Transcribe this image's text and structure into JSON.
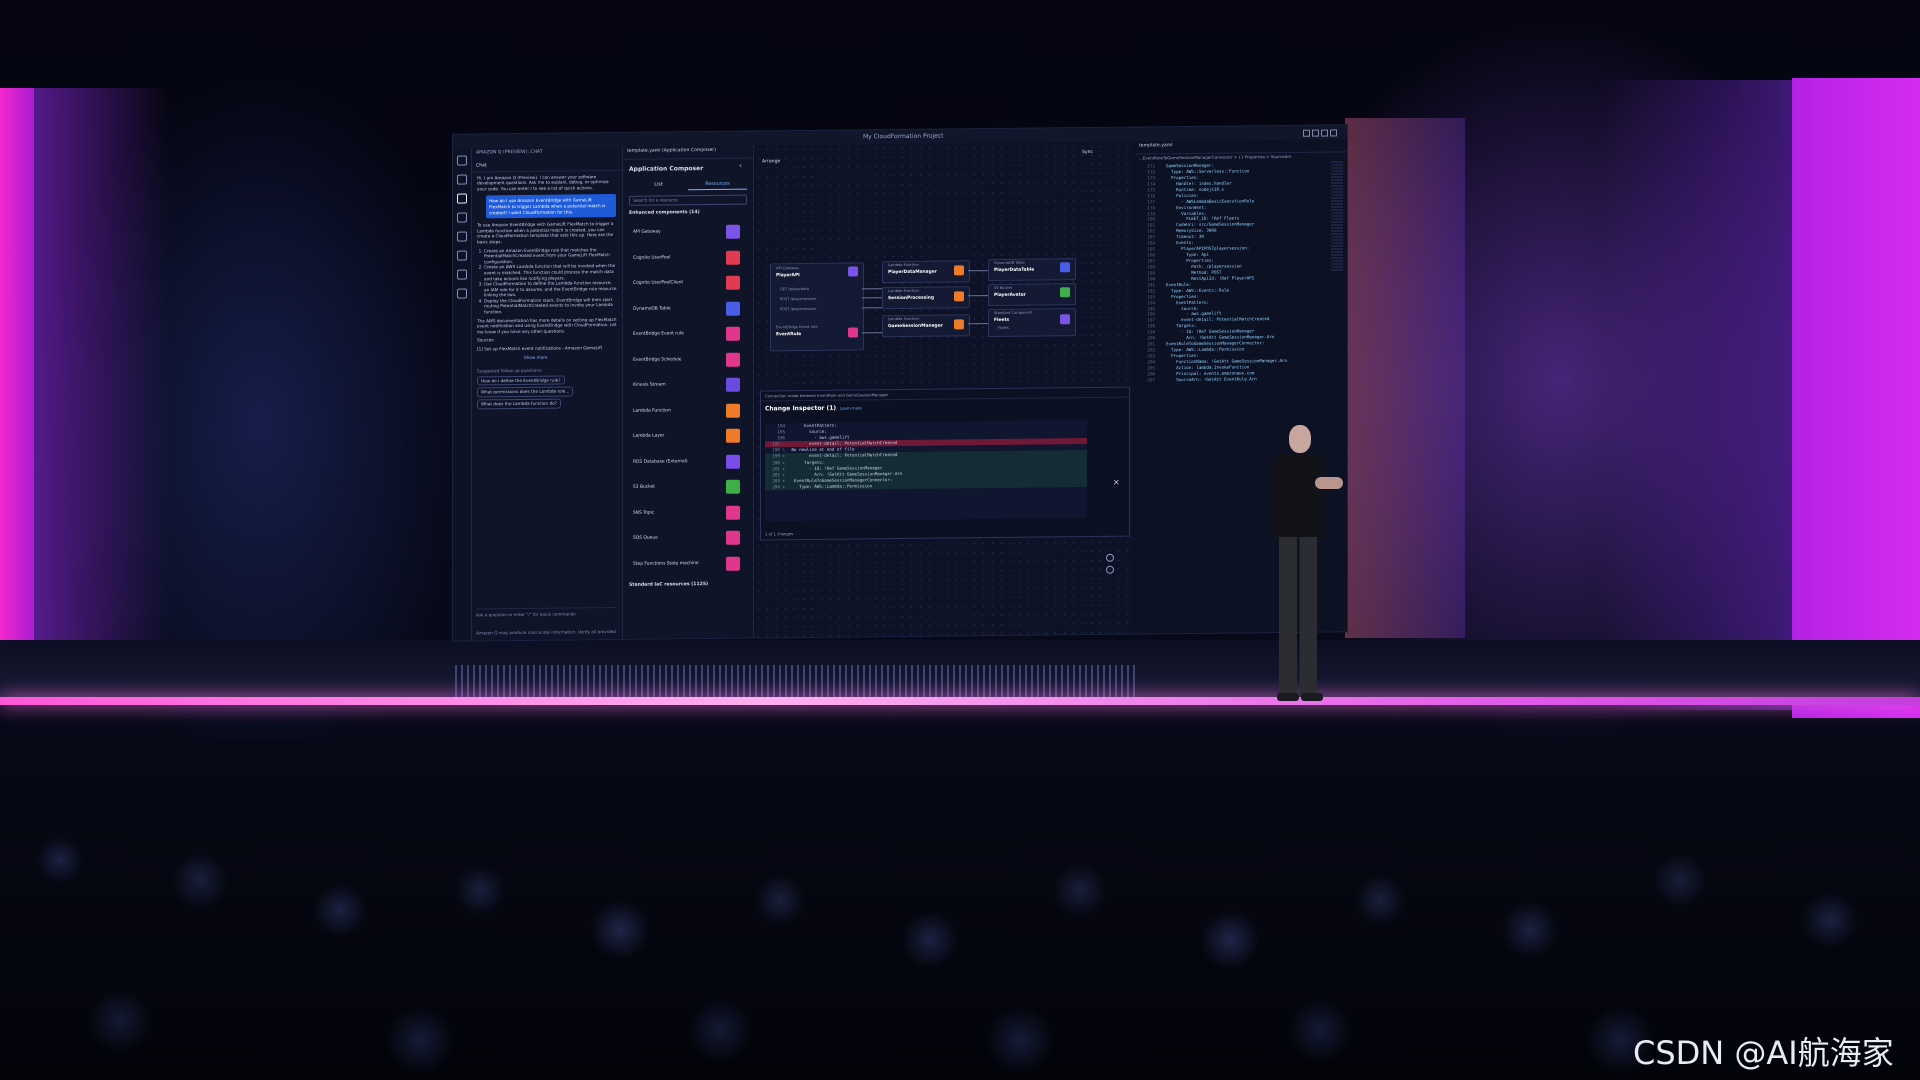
{
  "window": {
    "title": "My CloudFormation Project"
  },
  "chat": {
    "header": "AMAZON Q (PREVIEW): CHAT",
    "tab": "Chat",
    "intro": "Hi, I am Amazon Q (Preview). I can answer your software development questions. Ask me to explain, debug, or optimize your code. You can enter / to see a list of quick actions.",
    "question": "How do I use Amazon EventBridge with GameLift FlexMatch to trigger Lambda when a potential match is created? I want CloudFormation for this.",
    "answer_intro": "To use Amazon EventBridge with GameLift FlexMatch to trigger a Lambda function when a potential match is created, you can create a CloudFormation template that sets this up. Here are the basic steps:",
    "steps": [
      "Create an Amazon EventBridge rule that matches the PotentialMatchCreated event from your GameLift FlexMatch configuration.",
      "Create an AWS Lambda function that will be invoked when the event is matched. This function could process the match data and take actions like notifying players.",
      "Use CloudFormation to define the Lambda function resource, an IAM role for it to assume, and the EventBridge rule resource linking the two.",
      "Deploy the CloudFormation stack. EventBridge will then start routing PotentialMatchCreated events to invoke your Lambda function."
    ],
    "answer_outro": "The AWS documentation has more details on setting up FlexMatch event notification and using EventBridge with CloudFormation. Let me know if you have any other questions.",
    "sources_label": "Sources",
    "source_1": "[1] Set up FlexMatch event notifications - Amazon GameLift",
    "show_more": "Show more",
    "suggested_title": "Suggested follow up questions:",
    "suggestions": [
      "How do I define the EventBridge rule?",
      "What permissions does the Lambda role...",
      "What does the Lambda function do?"
    ],
    "input_placeholder": "Ask a question or enter \"/\" for quick commands",
    "disclaimer": "Amazon Q may produce inaccurate information. Verify all provided"
  },
  "composer": {
    "file_tab": "template.yaml (Application Composer)",
    "title": "Application Composer",
    "tabs": [
      "List",
      "Resources"
    ],
    "search_placeholder": "Search for a resource",
    "section_enhanced": "Enhanced components (14)",
    "section_standard": "Standard IaC resources (1125)",
    "resources": [
      {
        "name": "API Gateway",
        "color": "#7b53e8"
      },
      {
        "name": "Cognito UserPool",
        "color": "#e23a52"
      },
      {
        "name": "Cognito UserPoolClient",
        "color": "#e23a52"
      },
      {
        "name": "DynamoDB Table",
        "color": "#4a5de8"
      },
      {
        "name": "EventBridge Event rule",
        "color": "#e0368c"
      },
      {
        "name": "EventBridge Schedule",
        "color": "#e0368c"
      },
      {
        "name": "Kinesis Stream",
        "color": "#6a4be0"
      },
      {
        "name": "Lambda Function",
        "color": "#ef7a2a"
      },
      {
        "name": "Lambda Layer",
        "color": "#ef7a2a"
      },
      {
        "name": "RDS Database (External)",
        "color": "#7a4ce8"
      },
      {
        "name": "S3 Bucket",
        "color": "#3fae49"
      },
      {
        "name": "SNS Topic",
        "color": "#e0368c"
      },
      {
        "name": "SQS Queue",
        "color": "#e0368c"
      },
      {
        "name": "Step Functions State machine",
        "color": "#e0368c"
      }
    ]
  },
  "canvas": {
    "arrange": "Arrange",
    "sync": "Sync",
    "nodes": {
      "api": {
        "type": "API Gateway",
        "name": "PlayerAPI",
        "routes": [
          "GET /playerdata",
          "POST /playersession",
          "POST /playersession"
        ]
      },
      "eventbridge": {
        "type": "EventBridge Event rule",
        "name": "EventRule"
      },
      "lambda1": {
        "type": "Lambda Function",
        "name": "PlayerDataManager"
      },
      "lambda2": {
        "type": "Lambda Function",
        "name": "SessionProcessing"
      },
      "lambda3": {
        "type": "Lambda Function",
        "name": "GameSessionManager"
      },
      "dynamo": {
        "type": "DynamoDB Table",
        "name": "PlayerDataTable"
      },
      "s3": {
        "type": "S3 Bucket",
        "name": "PlayerAvatar"
      },
      "fleet": {
        "type": "Standard Component",
        "name": "Fleets",
        "sub": "Fleets"
      }
    }
  },
  "inspector": {
    "bar": "Connection made between EventRule and GameSessionManager",
    "title": "Change Inspector",
    "count": "(1)",
    "learn_more": "Learn more",
    "lines": [
      {
        "n": "194",
        "t": "      EventPattern:",
        "k": "ctx"
      },
      {
        "n": "195",
        "t": "        source:",
        "k": "ctx"
      },
      {
        "n": "196",
        "t": "          - aws.gamelift",
        "k": "ctx"
      },
      {
        "n": "197 -",
        "t": "        event-detail: PotentialMatchCreated",
        "k": "del"
      },
      {
        "n": "198 \\",
        "t": " No newline at end of file",
        "k": "ctx"
      },
      {
        "n": "199 +",
        "t": "        event-detail: PotentialMatchCreated",
        "k": "add"
      },
      {
        "n": "200 +",
        "t": "      Targets:",
        "k": "add"
      },
      {
        "n": "201 +",
        "t": "        - Id: !Ref GameSessionManager",
        "k": "add"
      },
      {
        "n": "202 +",
        "t": "          Arn: !GetAtt GameSessionManager.Arn",
        "k": "add"
      },
      {
        "n": "203 +",
        "t": "  EventRuleToGameSessionManagerConnector:",
        "k": "add"
      },
      {
        "n": "204 +",
        "t": "    Type: AWS::Lambda::Permission",
        "k": "add"
      }
    ],
    "footer": "1 of 1 changes"
  },
  "editor": {
    "file_tab": "template.yaml",
    "breadcrumb": "...EventRuleToGameSessionManagerConnector > {} Properties > SourceArn",
    "lines": [
      {
        "n": "171",
        "t": "  GameSessionManager:"
      },
      {
        "n": "172",
        "t": "    Type: AWS::Serverless::Function"
      },
      {
        "n": "173",
        "t": "    Properties:"
      },
      {
        "n": "174",
        "t": "      Handler: index.handler"
      },
      {
        "n": "175",
        "t": "      Runtime: nodejs18.x"
      },
      {
        "n": "176",
        "t": "      Policies:"
      },
      {
        "n": "177",
        "t": "        - AWSLambdaBasicExecutionRole"
      },
      {
        "n": "178",
        "t": "      Environment:"
      },
      {
        "n": "179",
        "t": "        Variables:"
      },
      {
        "n": "180",
        "t": "          FLEET_ID: !Ref Fleets"
      },
      {
        "n": "181",
        "t": "      CodeUri: src/GameSessionManager"
      },
      {
        "n": "182",
        "t": "      MemorySize: 3008"
      },
      {
        "n": "183",
        "t": "      Timeout: 30"
      },
      {
        "n": "184",
        "t": "      Events:"
      },
      {
        "n": "185",
        "t": "        PlayerAPIPOSTplayersession:"
      },
      {
        "n": "186",
        "t": "          Type: Api"
      },
      {
        "n": "187",
        "t": "          Properties:"
      },
      {
        "n": "188",
        "t": "            Path: /playersession"
      },
      {
        "n": "189",
        "t": "            Method: POST"
      },
      {
        "n": "190",
        "t": "            RestApiId: !Ref PlayerAPI"
      },
      {
        "n": "191",
        "t": "  EventRule:"
      },
      {
        "n": "192",
        "t": "    Type: AWS::Events::Rule"
      },
      {
        "n": "193",
        "t": "    Properties:"
      },
      {
        "n": "194",
        "t": "      EventPattern:"
      },
      {
        "n": "195",
        "t": "        source:"
      },
      {
        "n": "196",
        "t": "          - aws.gamelift"
      },
      {
        "n": "197",
        "t": "        event-detail: PotentialMatchCreated"
      },
      {
        "n": "198",
        "t": "      Targets:"
      },
      {
        "n": "199",
        "t": "        - Id: !Ref GameSessionManager"
      },
      {
        "n": "200",
        "t": "          Arn: !GetAtt GameSessionManager.Arn"
      },
      {
        "n": "201",
        "t": "  EventRuleToGameSessionManagerConnector:"
      },
      {
        "n": "202",
        "t": "    Type: AWS::Lambda::Permission"
      },
      {
        "n": "203",
        "t": "    Properties:"
      },
      {
        "n": "204",
        "t": "      FunctionName: !GetAtt GameSessionManager.Arn"
      },
      {
        "n": "205",
        "t": "      Action: lambda:InvokeFunction"
      },
      {
        "n": "206",
        "t": "      Principal: events.amazonaws.com"
      },
      {
        "n": "207",
        "t": "      SourceArn: !GetAtt EventRule.Arn"
      }
    ]
  },
  "watermark": "CSDN @AI航海家"
}
